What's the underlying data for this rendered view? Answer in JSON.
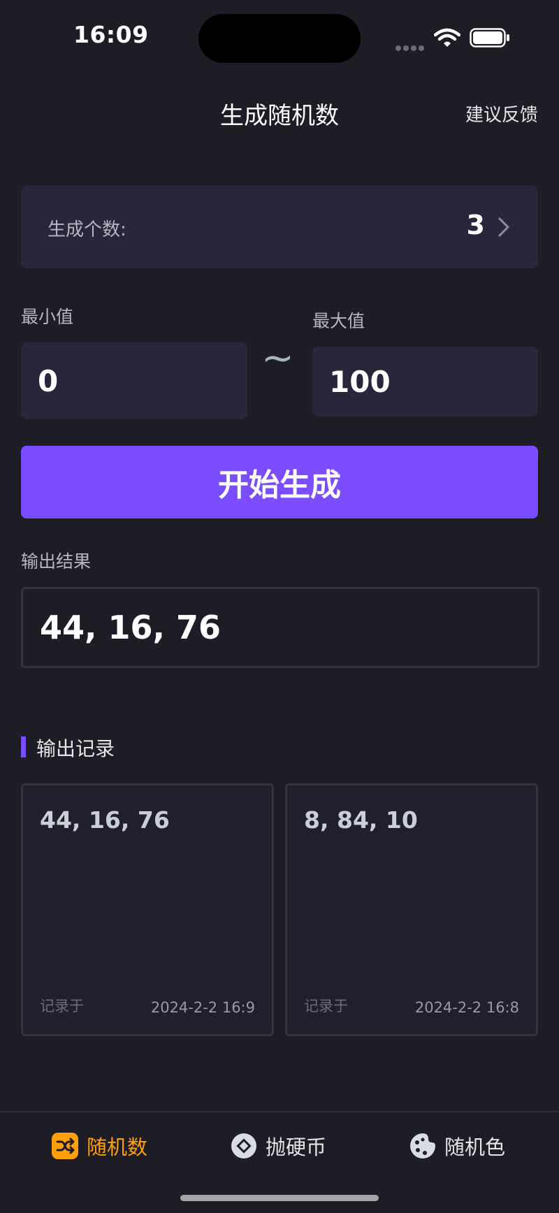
{
  "status_bar": {
    "time": "16:09"
  },
  "nav": {
    "title": "生成随机数",
    "feedback": "建议反馈"
  },
  "generator": {
    "count_label": "生成个数:",
    "count_value": "3",
    "min_label": "最小值",
    "min_value": "0",
    "range_separator": "~",
    "max_label": "最大值",
    "max_value": "100",
    "generate_button": "开始生成",
    "output_label": "输出结果",
    "output_value": "44, 16, 76"
  },
  "history": {
    "title": "输出记录",
    "records": [
      {
        "value": "44, 16, 76",
        "prefix": "记录于",
        "time": "2024-2-2 16:9"
      },
      {
        "value": "8, 84, 10",
        "prefix": "记录于",
        "time": "2024-2-2 16:8"
      }
    ]
  },
  "tabbar": {
    "tabs": [
      {
        "label": "随机数",
        "icon": "shuffle-icon",
        "active": true
      },
      {
        "label": "抛硬币",
        "icon": "coin-icon",
        "active": false
      },
      {
        "label": "随机色",
        "icon": "palette-icon",
        "active": false
      }
    ]
  },
  "colors": {
    "background": "#1e1c25",
    "card": "#29253a",
    "accent": "#7c4dff",
    "active_tab": "#ff9f0a"
  }
}
